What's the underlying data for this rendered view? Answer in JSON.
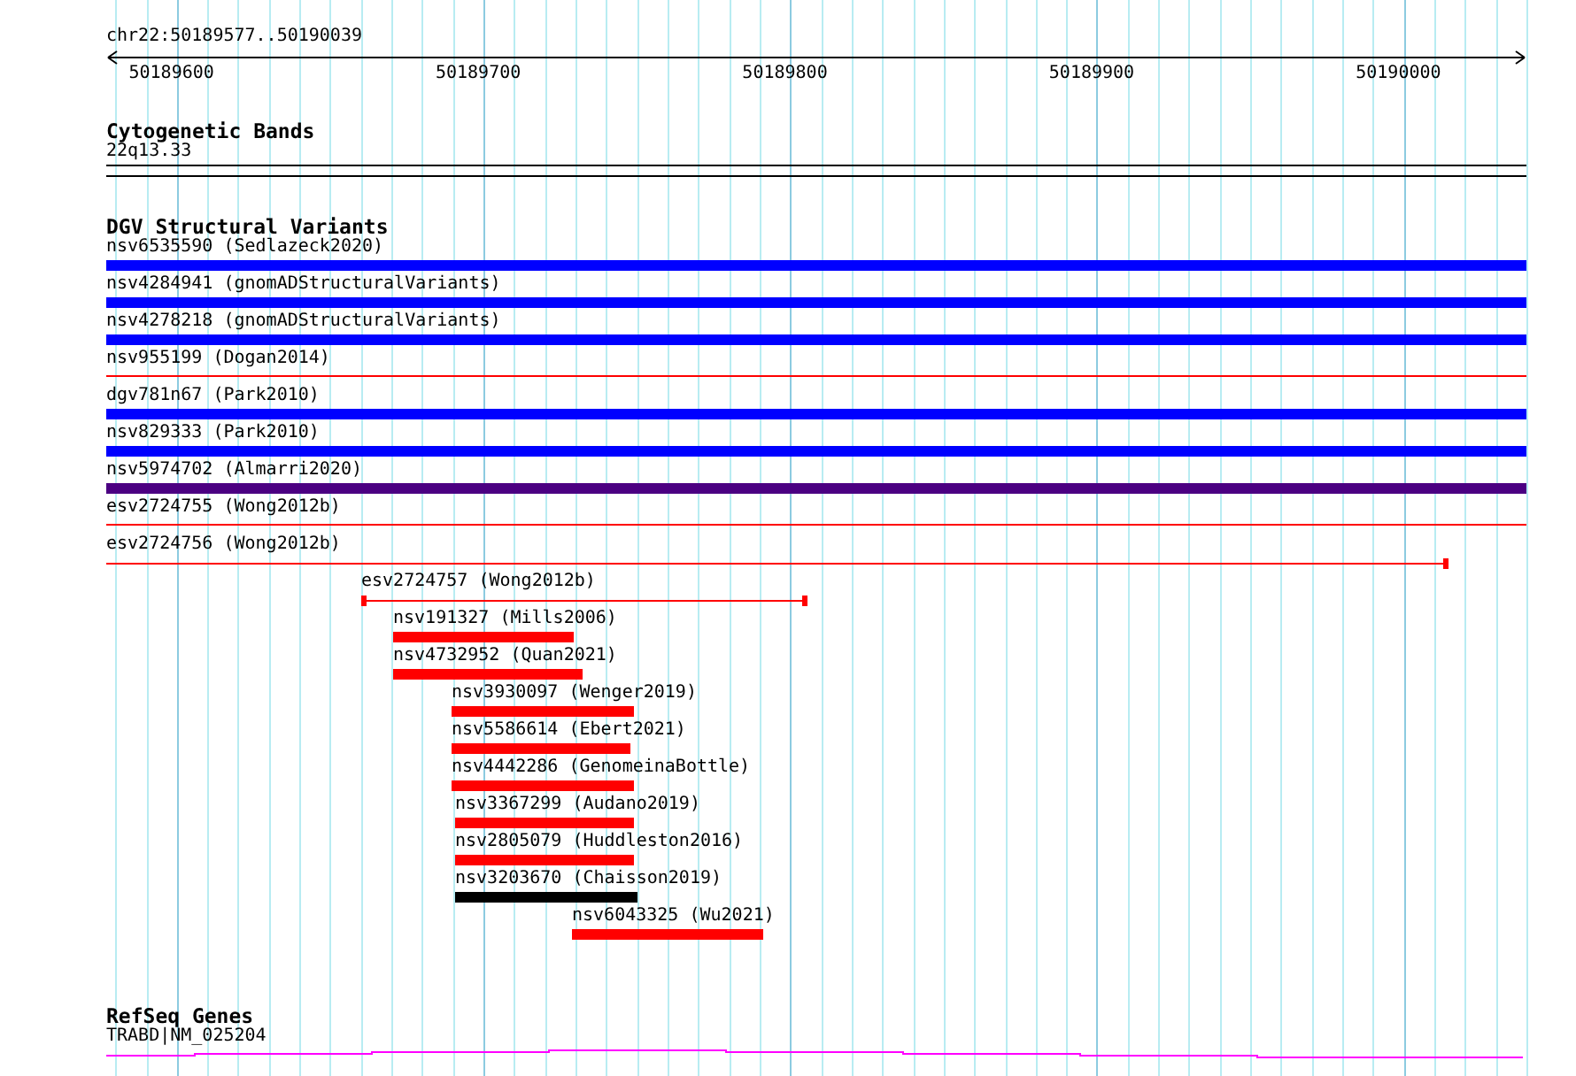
{
  "ruler": {
    "region": "chr22:50189577..50190039",
    "ticks": [
      "50189600",
      "50189700",
      "50189800",
      "50189900",
      "50190000"
    ]
  },
  "cytoband_track": {
    "title": "Cytogenetic Bands",
    "band": "22q13.33"
  },
  "variant_track": {
    "title": "DGV Structural Variants",
    "features": [
      {
        "label": "nsv6535590 (Sedlazeck2020)",
        "kind": "bar",
        "color": "#0000ff"
      },
      {
        "label": "nsv4284941 (gnomADStructuralVariants)",
        "kind": "bar",
        "color": "#0000ff"
      },
      {
        "label": "nsv4278218 (gnomADStructuralVariants)",
        "kind": "bar",
        "color": "#0000ff"
      },
      {
        "label": "nsv955199 (Dogan2014)",
        "kind": "line",
        "color": "#ff0000"
      },
      {
        "label": "dgv781n67 (Park2010)",
        "kind": "bar",
        "color": "#0000ff"
      },
      {
        "label": "nsv829333 (Park2010)",
        "kind": "bar",
        "color": "#0000ff"
      },
      {
        "label": "nsv5974702 (Almarri2020)",
        "kind": "bar",
        "color": "#4b0082"
      },
      {
        "label": "esv2724755 (Wong2012b)",
        "kind": "line",
        "color": "#ff0000"
      },
      {
        "label": "esv2724756 (Wong2012b)",
        "kind": "span",
        "color": "#ff0000"
      },
      {
        "label": "esv2724757 (Wong2012b)",
        "kind": "span",
        "color": "#ff0000"
      },
      {
        "label": "nsv191327 (Mills2006)",
        "kind": "bar",
        "color": "#ff0000"
      },
      {
        "label": "nsv4732952 (Quan2021)",
        "kind": "bar",
        "color": "#ff0000"
      },
      {
        "label": "nsv3930097 (Wenger2019)",
        "kind": "bar",
        "color": "#ff0000"
      },
      {
        "label": "nsv5586614 (Ebert2021)",
        "kind": "bar",
        "color": "#ff0000"
      },
      {
        "label": "nsv4442286 (GenomeinaBottle)",
        "kind": "bar",
        "color": "#ff0000"
      },
      {
        "label": "nsv3367299 (Audano2019)",
        "kind": "bar",
        "color": "#ff0000"
      },
      {
        "label": "nsv2805079 (Huddleston2016)",
        "kind": "bar",
        "color": "#ff0000"
      },
      {
        "label": "nsv3203670 (Chaisson2019)",
        "kind": "bar",
        "color": "#000000"
      },
      {
        "label": "nsv6043325 (Wu2021)",
        "kind": "bar",
        "color": "#ff0000"
      }
    ]
  },
  "gene_track": {
    "title": "RefSeq Genes",
    "gene": "TRABD|NM_025204"
  }
}
